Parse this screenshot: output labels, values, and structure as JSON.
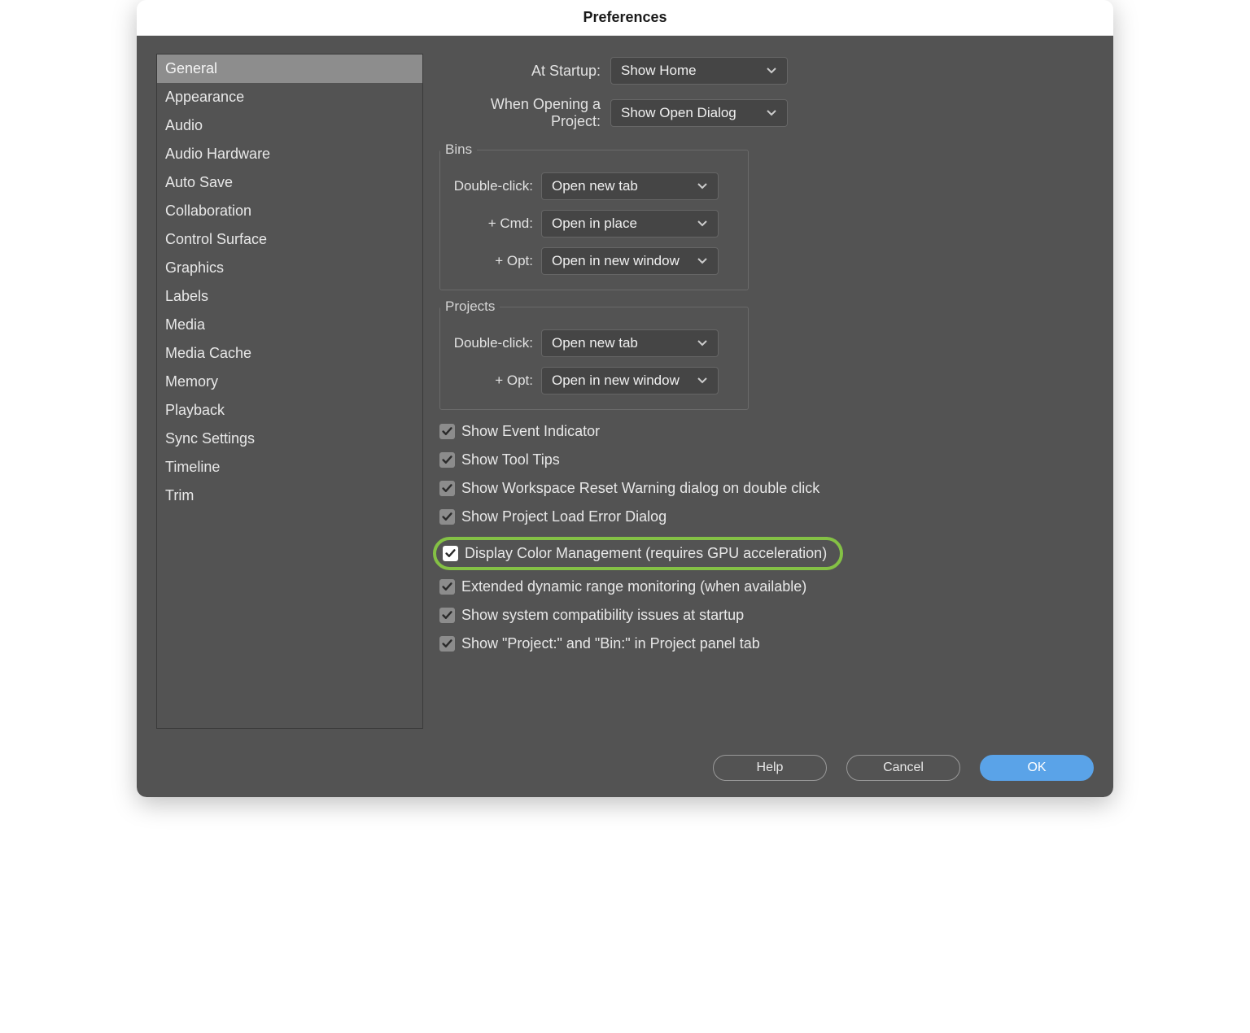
{
  "window": {
    "title": "Preferences"
  },
  "sidebar": {
    "items": [
      "General",
      "Appearance",
      "Audio",
      "Audio Hardware",
      "Auto Save",
      "Collaboration",
      "Control Surface",
      "Graphics",
      "Labels",
      "Media",
      "Media Cache",
      "Memory",
      "Playback",
      "Sync Settings",
      "Timeline",
      "Trim"
    ],
    "selected_index": 0
  },
  "startup": {
    "at_startup_label": "At Startup:",
    "at_startup_value": "Show Home",
    "on_open_label": "When Opening a Project:",
    "on_open_value": "Show Open Dialog"
  },
  "bins": {
    "legend": "Bins",
    "double_click_label": "Double-click:",
    "double_click_value": "Open new tab",
    "cmd_label": "+ Cmd:",
    "cmd_value": "Open in place",
    "opt_label": "+ Opt:",
    "opt_value": "Open in new window"
  },
  "projects": {
    "legend": "Projects",
    "double_click_label": "Double-click:",
    "double_click_value": "Open new tab",
    "opt_label": "+ Opt:",
    "opt_value": "Open in new window"
  },
  "checks": {
    "event_indicator": "Show Event Indicator",
    "tool_tips": "Show Tool Tips",
    "workspace_reset": "Show Workspace Reset Warning dialog on double click",
    "load_error": "Show Project Load Error Dialog",
    "color_mgmt": "Display Color Management (requires GPU acceleration)",
    "edr": "Extended dynamic range monitoring (when available)",
    "compat": "Show system compatibility issues at startup",
    "panel_tab": "Show \"Project:\" and \"Bin:\" in Project panel tab"
  },
  "buttons": {
    "help": "Help",
    "cancel": "Cancel",
    "ok": "OK"
  },
  "colors": {
    "highlight": "#84c145",
    "primary": "#5aa3e8"
  }
}
